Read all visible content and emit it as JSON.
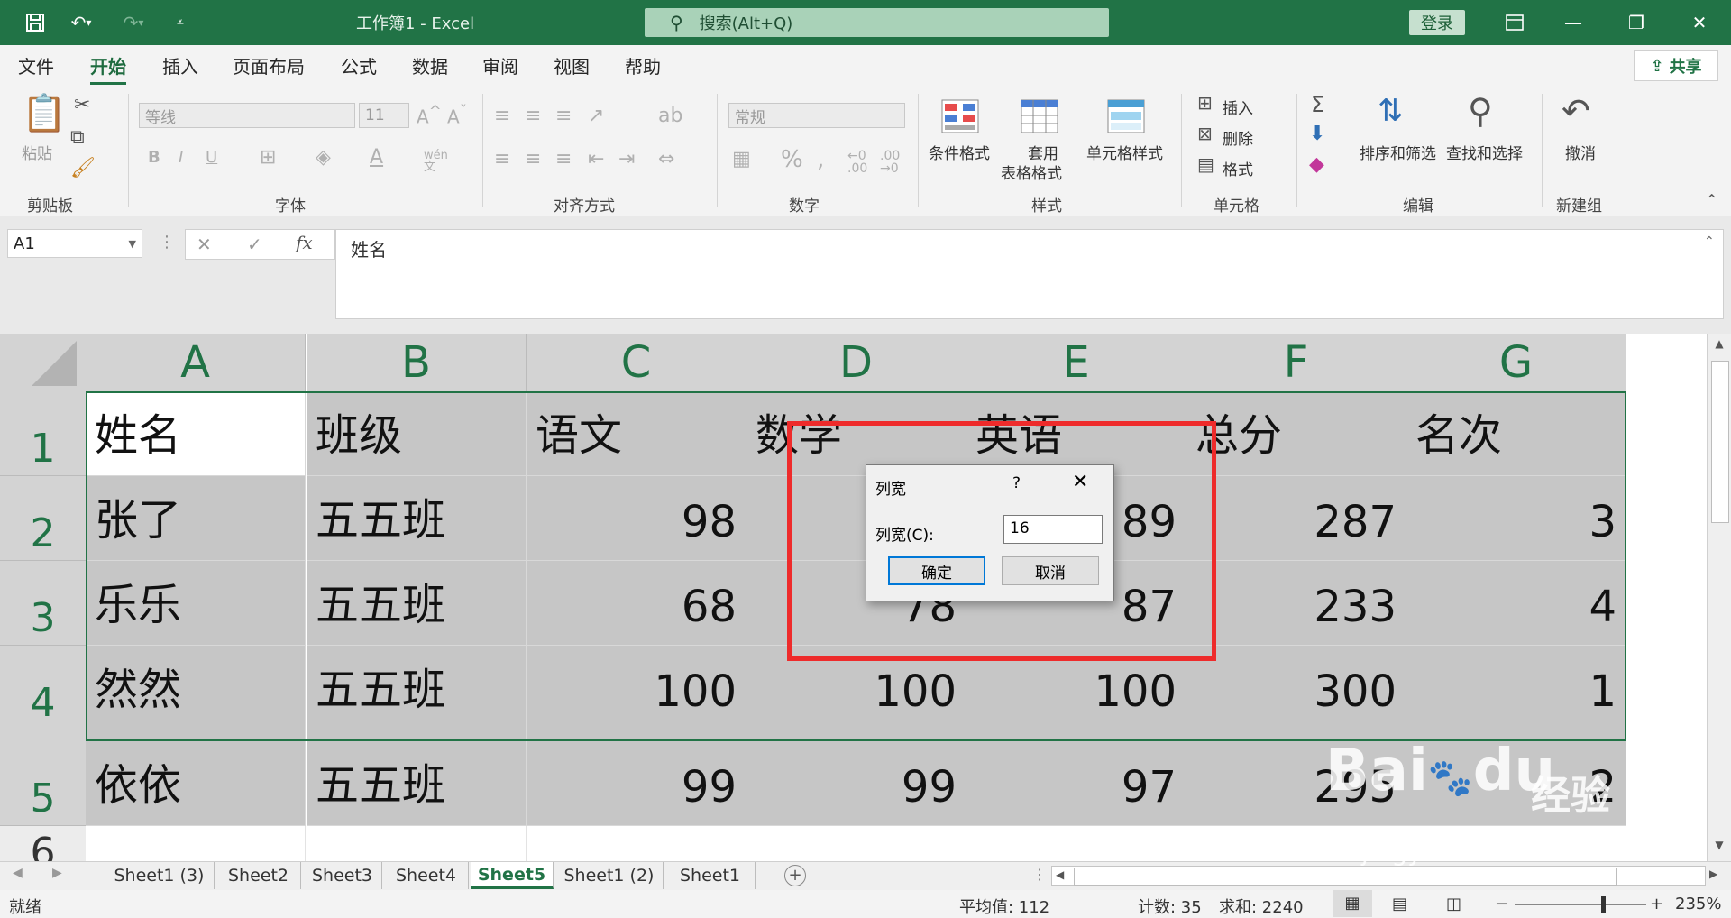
{
  "titlebar": {
    "title": "工作簿1 - Excel",
    "search_placeholder": "搜索(Alt+Q)",
    "login_label": "登录"
  },
  "menu": {
    "items": [
      "文件",
      "开始",
      "插入",
      "页面布局",
      "公式",
      "数据",
      "审阅",
      "视图",
      "帮助"
    ],
    "active_index": 1,
    "share_label": "共享"
  },
  "ribbon": {
    "paste_label": "粘贴",
    "font_name": "等线",
    "font_size": "11",
    "number_format": "常规",
    "conditional_format_label": "条件格式",
    "table_format_label_1": "套用",
    "table_format_label_2": "表格格式",
    "cell_style_label": "单元格样式",
    "insert_label": "插入",
    "delete_label": "删除",
    "format_label": "格式",
    "sort_filter_label": "排序和筛选",
    "find_select_label": "查找和选择",
    "undo_label": "撤消",
    "groups": {
      "clipboard": "剪贴板",
      "font": "字体",
      "alignment": "对齐方式",
      "number": "数字",
      "styles": "样式",
      "cells": "单元格",
      "editing": "编辑",
      "new_group": "新建组"
    }
  },
  "formula_bar": {
    "name_box": "A1",
    "formula": "姓名"
  },
  "grid": {
    "columns": [
      "A",
      "B",
      "C",
      "D",
      "E",
      "F",
      "G"
    ],
    "rows": [
      {
        "num": "1",
        "cells": [
          "姓名",
          "班级",
          "语文",
          "数学",
          "英语",
          "总分",
          "名次"
        ]
      },
      {
        "num": "2",
        "cells": [
          "张了",
          "五五班",
          "98",
          "",
          "89",
          "287",
          "3"
        ]
      },
      {
        "num": "3",
        "cells": [
          "乐乐",
          "五五班",
          "68",
          "78",
          "87",
          "233",
          "4"
        ]
      },
      {
        "num": "4",
        "cells": [
          "然然",
          "五五班",
          "100",
          "100",
          "100",
          "300",
          "1"
        ]
      },
      {
        "num": "5",
        "cells": [
          "依依",
          "五五班",
          "99",
          "99",
          "97",
          "295",
          "2"
        ]
      },
      {
        "num": "6",
        "cells": [
          "",
          "",
          "",
          "",
          "",
          "",
          ""
        ]
      }
    ]
  },
  "sheets": {
    "tabs": [
      "Sheet1 (3)",
      "Sheet2",
      "Sheet3",
      "Sheet4",
      "Sheet5",
      "Sheet1 (2)",
      "Sheet1"
    ],
    "active_index": 4
  },
  "status": {
    "ready": "就绪",
    "average": "平均值: 112",
    "count": "计数: 35",
    "sum": "求和: 2240",
    "zoom": "235%"
  },
  "dialog": {
    "title": "列宽",
    "help": "?",
    "field_label": "列宽(C):",
    "value": "16",
    "ok_label": "确定",
    "cancel_label": "取消"
  },
  "watermark": {
    "brand": "Bai",
    "brand2": "du",
    "cn": "经验",
    "url": "jingyan.baidu.com"
  },
  "colors": {
    "excel_green": "#217346",
    "selection_gray": "#c6c6c6",
    "highlight_red": "#ee2b2b"
  }
}
